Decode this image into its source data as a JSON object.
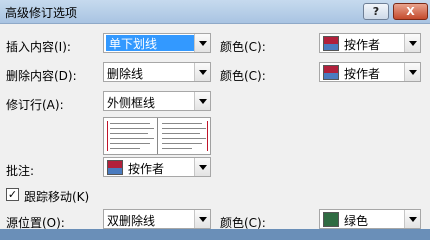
{
  "window": {
    "title": "高级修订选项",
    "help_label": "?",
    "close_label": "X"
  },
  "rows": {
    "insert": {
      "label": "插入内容(I):",
      "value": "单下划线",
      "color_label": "颜色(C):",
      "color_value": "按作者"
    },
    "delete": {
      "label": "删除内容(D):",
      "value": "删除线",
      "color_label": "颜色(C):",
      "color_value": "按作者"
    },
    "revision_line": {
      "label": "修订行(A):",
      "value": "外侧框线"
    },
    "comment": {
      "label": "批注:",
      "color_value": "按作者"
    },
    "track_moves": {
      "label": "跟踪移动(K)",
      "checked": true,
      "check_glyph": "✓"
    },
    "source": {
      "label": "源位置(O):",
      "value": "双删除线",
      "color_label": "颜色(C):",
      "color_value": "绿色"
    }
  },
  "colors": {
    "by_author_top": "#b1203b",
    "by_author_bottom": "#4a7bbf",
    "green": "#2f6b42",
    "selection": "#3399ff"
  }
}
